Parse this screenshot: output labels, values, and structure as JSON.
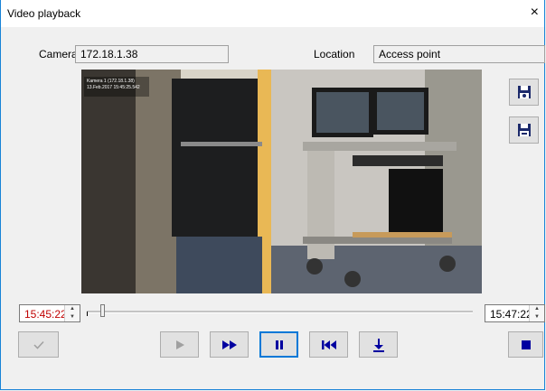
{
  "window": {
    "title": "Video playback",
    "close_glyph": "×"
  },
  "camera": {
    "label": "Camera",
    "value": "172.18.1.38"
  },
  "location": {
    "label": "Location",
    "value": "Access point"
  },
  "video": {
    "overlay_line1": "Kamera 1 (172.18.1.38)",
    "overlay_line2": "13.Feb.2017  15:45:25.542"
  },
  "side_buttons": [
    {
      "icon": "save-snapshot-icon"
    },
    {
      "icon": "save-video-icon"
    }
  ],
  "playback": {
    "start_time": "15:45:22",
    "end_time": "15:47:22",
    "position": 0.04
  },
  "controls": [
    {
      "icon": "checkmark-icon",
      "enabled": false
    },
    {
      "icon": "play-icon",
      "enabled": false
    },
    {
      "icon": "fast-forward-icon",
      "enabled": true
    },
    {
      "icon": "pause-icon",
      "enabled": true
    },
    {
      "icon": "skip-to-start-icon",
      "enabled": true
    },
    {
      "icon": "download-icon",
      "enabled": true
    },
    {
      "icon": "stop-icon",
      "enabled": true
    }
  ],
  "colors": {
    "time_text": "#c00000",
    "icon_blue": "#0000a0",
    "disabled": "#a0a0a0",
    "accent_border": "#1883d7"
  }
}
